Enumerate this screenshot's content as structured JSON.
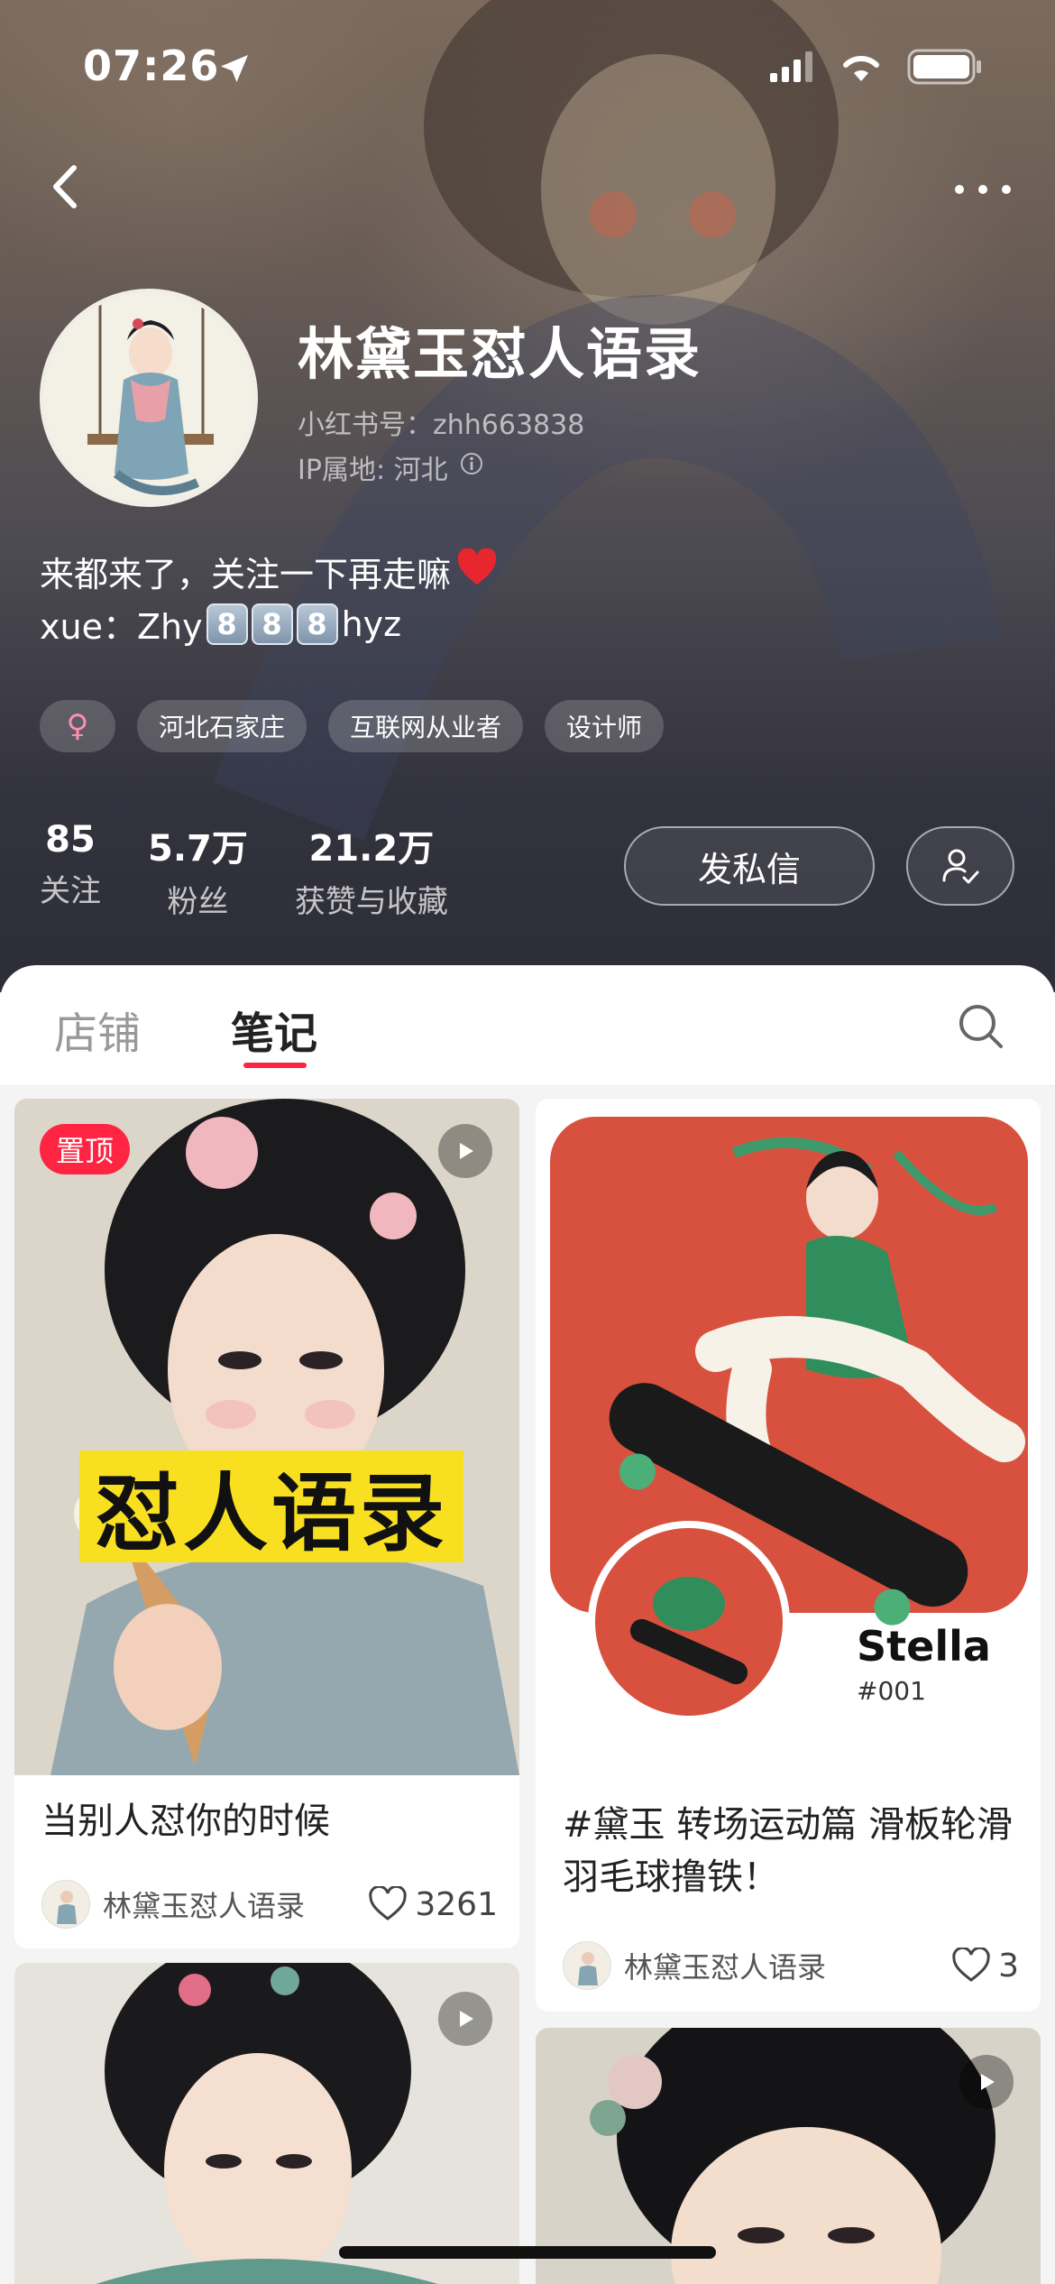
{
  "status_bar": {
    "time": "07:26"
  },
  "profile": {
    "nickname": "林黛玉怼人语录",
    "id_label": "小红书号：zhh663838",
    "ip_label": "IP属地: 河北",
    "bio_line1": "来都来了，关注一下再走嘛",
    "bio_line2_prefix": "xue：Zhy",
    "bio_keycaps": [
      "8",
      "8",
      "8"
    ],
    "bio_line2_suffix": "hyz",
    "tags": {
      "gender": "♀",
      "items": [
        "河北石家庄",
        "互联网从业者",
        "设计师"
      ]
    },
    "stats": [
      {
        "value": "85",
        "label": "关注"
      },
      {
        "value": "5.7万",
        "label": "粉丝"
      },
      {
        "value": "21.2万",
        "label": "获赞与收藏"
      }
    ],
    "dm_button": "发私信"
  },
  "tabs": {
    "shop": "店铺",
    "notes": "笔记",
    "active": "笔记"
  },
  "notes": [
    {
      "pinned_label": "置顶",
      "cover_text": "怼人语录",
      "title": "当别人怼你的时候",
      "author": "林黛玉怼人语录",
      "likes": "3261",
      "is_video": true
    },
    {
      "cover_name": "Stella",
      "cover_code": "#001",
      "title": "#黛玉 转场运动篇 滑板轮滑羽毛球撸铁！",
      "author": "林黛玉怼人语录",
      "likes": "3",
      "is_video": false
    },
    {
      "is_video": true
    },
    {
      "is_video": true
    }
  ],
  "colors": {
    "accent": "#ff2442",
    "header_dark": "#2d2d38"
  }
}
